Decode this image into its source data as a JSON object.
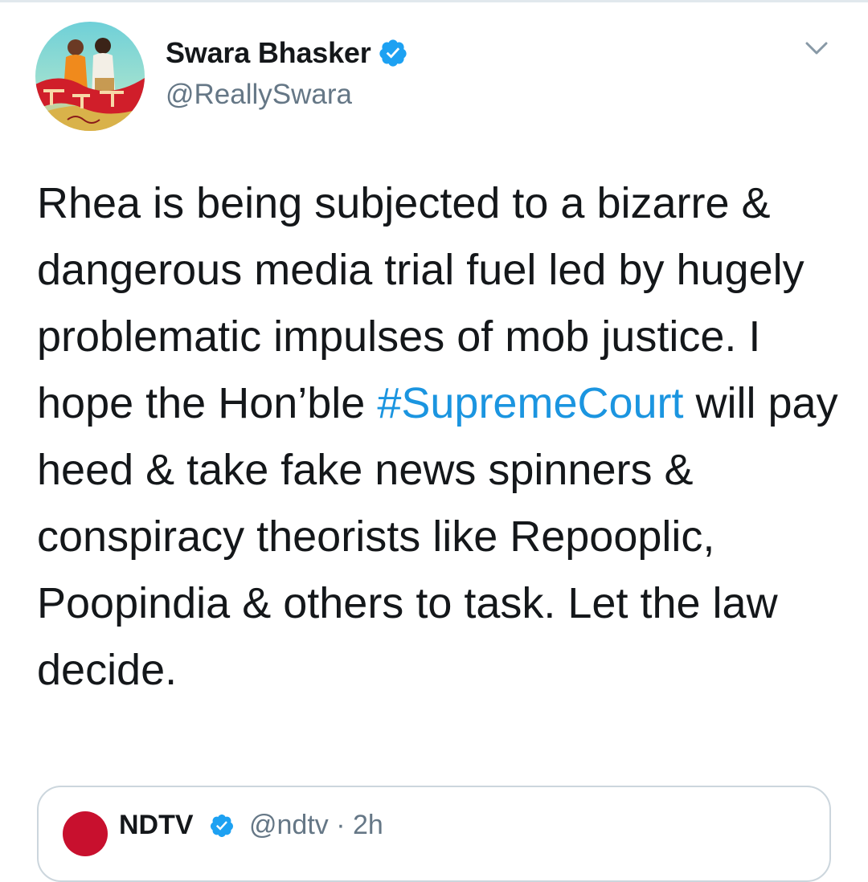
{
  "tweet": {
    "author": {
      "display_name": "Swara Bhasker",
      "handle": "@ReallySwara",
      "verified": true,
      "avatar_icon": "profile-photo"
    },
    "menu_icon": "chevron-down-icon",
    "text_segments": [
      "Rhea is being subjected to a bizarre & dangerous media trial fuel led by hugely problematic impulses of mob justice. I hope the Hon’ble ",
      "#SupremeCourt",
      " will pay heed & take fake news spinners & conspiracy theorists like Repooplic, Poopindia & others to task. Let the law decide."
    ]
  },
  "quoted_tweet": {
    "display_name": "NDTV",
    "handle": "@ndtv · 2h",
    "verified": true
  },
  "colors": {
    "text": "#14171a",
    "secondary": "#657786",
    "link": "#1b95e0",
    "verified": "#1da1f2",
    "border": "#ccd6dd"
  }
}
